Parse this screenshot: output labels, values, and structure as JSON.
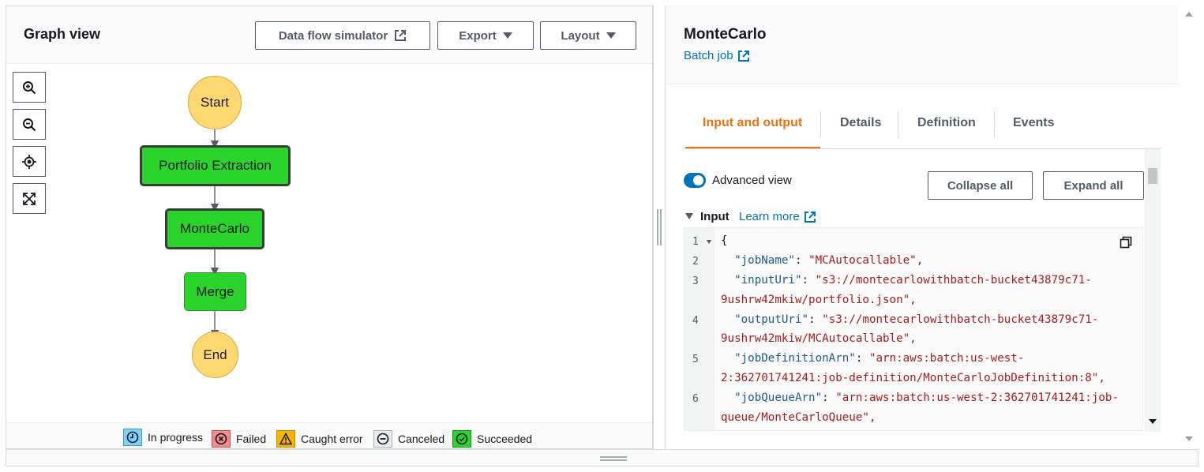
{
  "graph": {
    "title": "Graph view",
    "buttons": {
      "data_flow_simulator": "Data flow simulator",
      "export": "Export",
      "layout": "Layout"
    },
    "tools": [
      {
        "name": "zoom-in-icon"
      },
      {
        "name": "zoom-out-icon"
      },
      {
        "name": "center-icon"
      },
      {
        "name": "fit-screen-icon"
      }
    ],
    "nodes": {
      "start": "Start",
      "portfolio_extraction": "Portfolio Extraction",
      "montecarlo": "MonteCarlo",
      "merge": "Merge",
      "end": "End"
    },
    "legend": {
      "in_progress": "In progress",
      "failed": "Failed",
      "caught_error": "Caught error",
      "canceled": "Canceled",
      "succeeded": "Succeeded"
    },
    "colors": {
      "succeeded": "#2bd42b",
      "start_end": "#ffd871",
      "in_progress": "#7ed1f2",
      "failed": "#f38c8c",
      "caught_error": "#f5b400",
      "canceled": "#eaeded"
    }
  },
  "detail": {
    "title": "MonteCarlo",
    "type_link": "Batch job",
    "tabs": [
      "Input and output",
      "Details",
      "Definition",
      "Events"
    ],
    "active_tab": "Input and output",
    "advanced_view_label": "Advanced view",
    "advanced_view_on": true,
    "collapse_all": "Collapse all",
    "expand_all": "Expand all",
    "input_label": "Input",
    "learn_more": "Learn more",
    "accent": "#ec7211",
    "link_color": "#0073bb",
    "code": {
      "line_numbers": [
        "1",
        "2",
        "3",
        "4",
        "5",
        "6"
      ],
      "open_brace": "{",
      "rows": [
        {
          "key": "\"jobName\"",
          "value": "\"MCAutocallable\","
        },
        {
          "key": "\"inputUri\"",
          "value": "\"s3://montecarlowithbatch-bucket43879c71-",
          "cont": "9ushrw42mkiw/portfolio.json\","
        },
        {
          "key": "\"outputUri\"",
          "value": "\"s3://montecarlowithbatch-bucket43879c71-",
          "cont": "9ushrw42mkiw/MCAutocallable\","
        },
        {
          "key": "\"jobDefinitionArn\"",
          "value": "\"arn:aws:batch:us-west-",
          "cont": "2:362701741241:job-definition/MonteCarloJobDefinition:8\","
        },
        {
          "key": "\"jobQueueArn\"",
          "value": "\"arn:aws:batch:us-west-2:362701741241:job-",
          "cont": "queue/MonteCarloQueue\","
        }
      ]
    }
  }
}
